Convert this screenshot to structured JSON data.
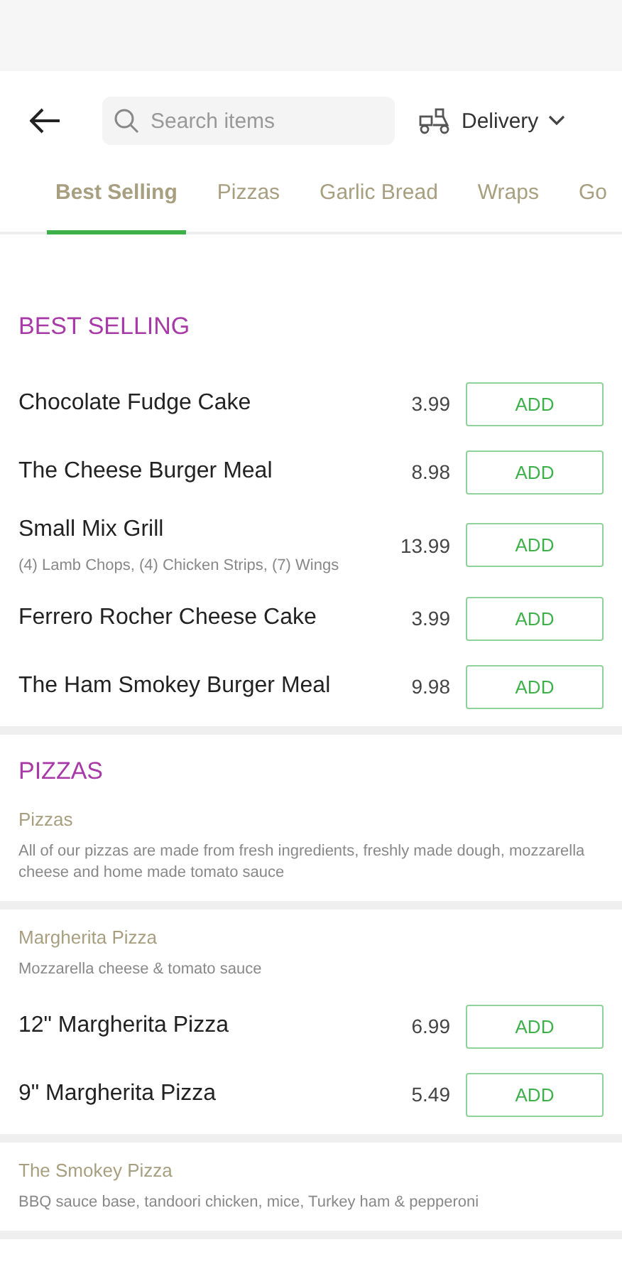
{
  "header": {
    "search": {
      "placeholder": "Search items"
    },
    "delivery": {
      "label": "Delivery"
    }
  },
  "tabs": [
    {
      "label": "Best Selling",
      "selected": true
    },
    {
      "label": "Pizzas",
      "selected": false
    },
    {
      "label": "Garlic Bread",
      "selected": false
    },
    {
      "label": "Wraps",
      "selected": false
    },
    {
      "label": "Go",
      "selected": false
    }
  ],
  "blocks": [
    {
      "section_title": "BEST SELLING",
      "items": [
        {
          "name": "Chocolate Fudge Cake",
          "price": "3.99",
          "button": "ADD"
        },
        {
          "name": "The Cheese Burger Meal",
          "price": "8.98",
          "button": "ADD"
        },
        {
          "name": "Small Mix Grill",
          "description": "(4) Lamb Chops, (4) Chicken Strips, (7) Wings",
          "price": "13.99",
          "button": "ADD"
        },
        {
          "name": "Ferrero Rocher Cheese Cake",
          "price": "3.99",
          "button": "ADD"
        },
        {
          "name": "The Ham Smokey Burger Meal",
          "price": "9.98",
          "button": "ADD"
        }
      ]
    },
    {
      "section_title": "PIZZAS",
      "heading": "Pizzas",
      "description": "All of our pizzas are made from fresh ingredients, freshly made dough, mozzarella cheese and home made tomato sauce"
    },
    {
      "heading": "Margherita Pizza",
      "description": "Mozzarella cheese & tomato sauce",
      "items": [
        {
          "name": "12\" Margherita Pizza",
          "price": "6.99",
          "button": "ADD"
        },
        {
          "name": "9\" Margherita Pizza",
          "price": "5.49",
          "button": "ADD"
        }
      ]
    },
    {
      "heading": "The Smokey Pizza",
      "description": "BBQ sauce base, tandoori chicken, mice, Turkey ham & pepperoni"
    }
  ]
}
